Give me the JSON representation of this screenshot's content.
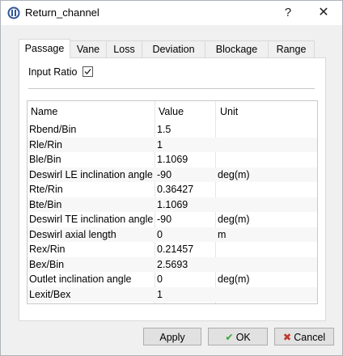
{
  "window": {
    "title": "Return_channel",
    "help_glyph": "?",
    "close_glyph": "✕",
    "icon": "app-logo-icon"
  },
  "tabs": [
    {
      "label": "Passage",
      "active": true
    },
    {
      "label": "Vane",
      "active": false
    },
    {
      "label": "Loss",
      "active": false
    },
    {
      "label": "Deviation",
      "active": false
    },
    {
      "label": "Blockage",
      "active": false
    },
    {
      "label": "Range",
      "active": false
    }
  ],
  "input_ratio": {
    "label": "Input Ratio",
    "checked": true
  },
  "table": {
    "headers": [
      "Name",
      "Value",
      "Unit"
    ],
    "rows": [
      [
        "Rbend/Bin",
        "1.5",
        ""
      ],
      [
        "Rle/Rin",
        "1",
        ""
      ],
      [
        "Ble/Bin",
        "1.1069",
        ""
      ],
      [
        "Deswirl LE inclination angle",
        "-90",
        "deg(m)"
      ],
      [
        "Rte/Rin",
        "0.36427",
        ""
      ],
      [
        "Bte/Bin",
        "1.1069",
        ""
      ],
      [
        "Deswirl TE inclination angle",
        "-90",
        "deg(m)"
      ],
      [
        "Deswirl axial length",
        "0",
        "m"
      ],
      [
        "Rex/Rin",
        "0.21457",
        ""
      ],
      [
        "Bex/Bin",
        "2.5693",
        ""
      ],
      [
        "Outlet inclination angle",
        "0",
        "deg(m)"
      ],
      [
        "Lexit/Bex",
        "1",
        ""
      ]
    ]
  },
  "buttons": {
    "apply": "Apply",
    "ok": "OK",
    "cancel": "Cancel",
    "ok_icon": "checkmark-icon",
    "cancel_icon": "cancel-icon",
    "ok_color": "#3aa935",
    "cancel_color": "#c0392b"
  }
}
